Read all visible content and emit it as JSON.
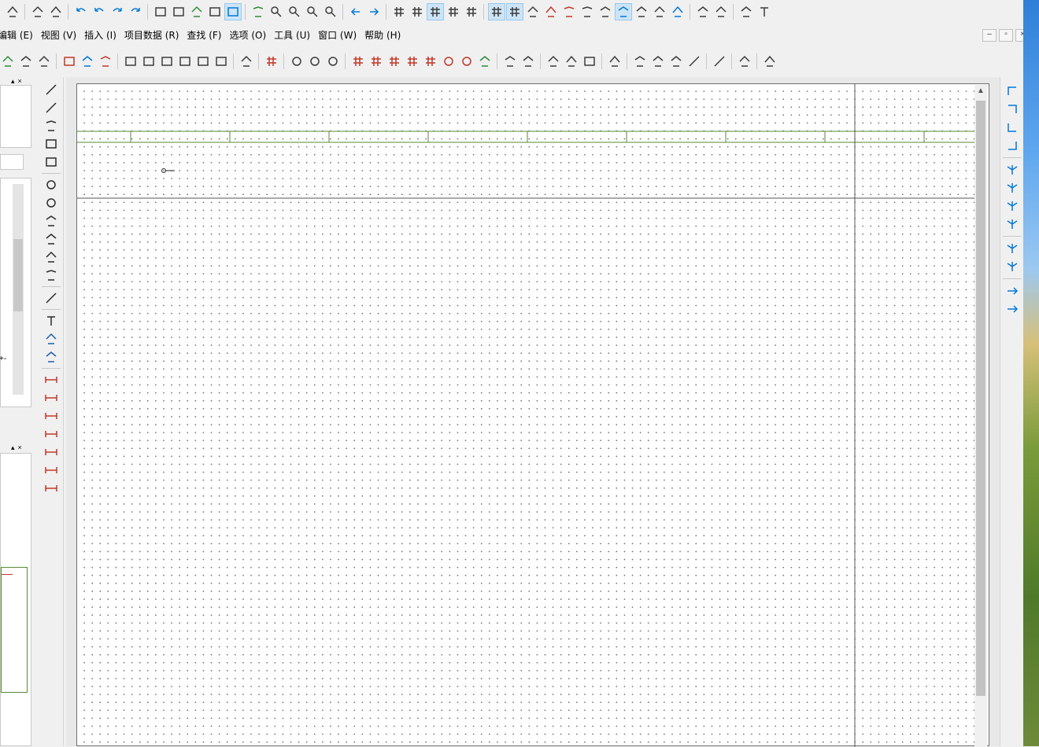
{
  "menubar": {
    "items": [
      {
        "label": "编辑 (E)"
      },
      {
        "label": "视图 (V)"
      },
      {
        "label": "插入 (I)"
      },
      {
        "label": "项目数据 (R)"
      },
      {
        "label": "查找 (F)"
      },
      {
        "label": "选项 (O)"
      },
      {
        "label": "工具 (U)"
      },
      {
        "label": "窗口 (W)"
      },
      {
        "label": "帮助 (H)"
      }
    ]
  },
  "window_controls": {
    "minimize": "–",
    "restore": "▫",
    "close": "×"
  },
  "panels": {
    "pin_symbol": "▴",
    "close_symbol": "×",
    "tree_fragment": "+-"
  },
  "toolbar_top": {
    "icons": [
      "select-icon",
      "brush-icon",
      "brush2-icon",
      "undo-icon",
      "undo2-icon",
      "redo-icon",
      "redo2-icon",
      "page-layout-icon",
      "page-setup-icon",
      "check-icon",
      "table-icon",
      "monitor-icon",
      "refresh-icon",
      "zoom-fit-icon",
      "zoom-in-icon",
      "zoom-out-icon",
      "zoom-100-icon",
      "arrow-left-icon",
      "arrow-right-icon",
      "grid-a-icon",
      "grid-b-icon",
      "grid-c-icon",
      "grid-d-icon",
      "grid-e-icon",
      "grid-toggle-icon",
      "snap-grid-icon",
      "frame-icon",
      "magnet-icon",
      "magnet2-icon",
      "connect-icon",
      "component-icon",
      "bar-icon",
      "wave-icon",
      "wave2-icon",
      "arrows-icon",
      "move-icon",
      "select-area-icon",
      "cart-icon",
      "text-frame-icon"
    ],
    "active": [
      "monitor-icon",
      "grid-c-icon",
      "grid-toggle-icon",
      "snap-grid-icon",
      "bar-icon"
    ]
  },
  "toolbar_second": {
    "icons": [
      "check-green-icon",
      "flag-icon",
      "flag2-icon",
      "red-box-icon",
      "move-arrow-icon",
      "delete-x-icon",
      "doc-icon",
      "doc-new-icon",
      "doc-edit-icon",
      "doc-star-icon",
      "doc-back-icon",
      "doc-forward-icon",
      "layer-icon",
      "grid-red-icon",
      "target-icon",
      "target2-icon",
      "target3-icon",
      "bus-icon",
      "bus2-icon",
      "bus3-icon",
      "bus4-icon",
      "bus5-icon",
      "circle-a-icon",
      "circle-b-icon",
      "green-wave-icon",
      "pin-icon",
      "pin2-icon",
      "hatch-icon",
      "hatch2-icon",
      "dashed-box-icon",
      "ground-icon",
      "connector-icon",
      "connector2-icon",
      "connector3-icon",
      "line-cross-icon",
      "line-cross2-icon",
      "angle-icon",
      "angle2-icon"
    ]
  },
  "draw_tools": {
    "icons": [
      "line-icon",
      "polyline-icon",
      "polygon-icon",
      "rectangle-icon",
      "text-box-icon",
      "circle-icon",
      "circle2-icon",
      "arc-icon",
      "arc2-icon",
      "ellipse-arc-icon",
      "ellipse-icon",
      "spline-icon",
      "text-icon",
      "image-icon",
      "link-icon",
      "dimension-icon",
      "dimension2-icon",
      "dimension3-icon",
      "dimension4-icon",
      "dimension5-icon",
      "angle-dim-icon",
      "radius-dim-icon"
    ]
  },
  "corner_tools": {
    "icons": [
      "corner-tl-icon",
      "corner-tr-icon",
      "corner-bl-icon",
      "corner-br-icon",
      "branch-icon",
      "branch2-icon",
      "branch3-icon",
      "branch4-icon",
      "tee-icon",
      "tee2-icon",
      "jump-icon",
      "jump2-icon"
    ]
  },
  "colors": {
    "accent": "#0078d7",
    "grid_dot": "#6b6b6b",
    "border_green": "#5a8a32",
    "dim_red": "#c0392b"
  }
}
